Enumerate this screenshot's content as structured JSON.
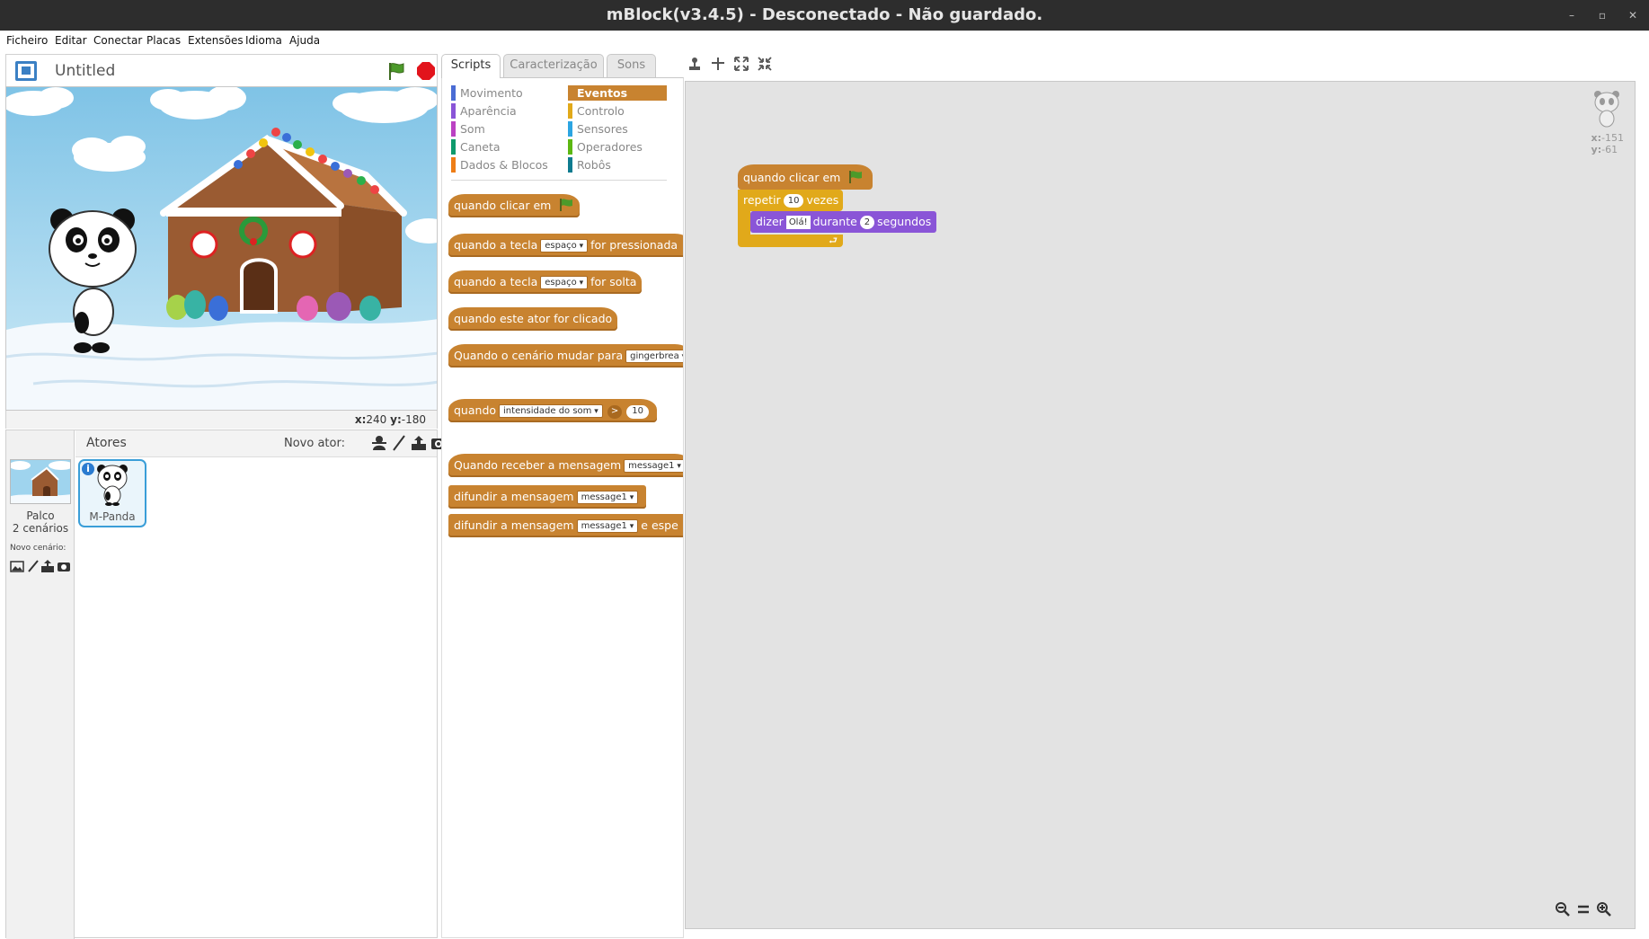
{
  "window": {
    "title": "mBlock(v3.4.5) - Desconectado - Não guardado.",
    "controls": [
      "–",
      "▫",
      "✕"
    ]
  },
  "menu": [
    "Ficheiro",
    "Editar",
    "Conectar",
    "Placas",
    "Extensões",
    "Idioma",
    "Ajuda"
  ],
  "stage": {
    "project_title": "Untitled",
    "coords": {
      "x_label": "x:",
      "x": "240",
      "y_label": "y:",
      "y": "-180"
    }
  },
  "sprites": {
    "header": "Atores",
    "new_sprite": "Novo ator:",
    "stage_label": "Palco",
    "stage_backdrops": "2 cenários",
    "new_backdrop": "Novo cenário:",
    "list": [
      {
        "name": "M-Panda",
        "info": "i"
      }
    ]
  },
  "tabs": [
    "Scripts",
    "Caracterização",
    "Sons"
  ],
  "categories": [
    {
      "label": "Movimento",
      "color": "#4a6cd4",
      "selected": false
    },
    {
      "label": "Eventos",
      "color": "#c88330",
      "selected": true
    },
    {
      "label": "Aparência",
      "color": "#8a55d7",
      "selected": false
    },
    {
      "label": "Controlo",
      "color": "#e1a91a",
      "selected": false
    },
    {
      "label": "Som",
      "color": "#bb42c3",
      "selected": false
    },
    {
      "label": "Sensores",
      "color": "#2ca5e2",
      "selected": false
    },
    {
      "label": "Caneta",
      "color": "#0e9a6c",
      "selected": false
    },
    {
      "label": "Operadores",
      "color": "#5cb712",
      "selected": false
    },
    {
      "label": "Dados & Blocos",
      "color": "#ee7d16",
      "selected": false
    },
    {
      "label": "Robôs",
      "color": "#0e7b8f",
      "selected": false
    }
  ],
  "palette_blocks": {
    "b1": {
      "t1": "quando clicar em"
    },
    "b2": {
      "t1": "quando a tecla",
      "dd": "espaço",
      "t2": "for pressionada"
    },
    "b3": {
      "t1": "quando a tecla",
      "dd": "espaço",
      "t2": "for solta"
    },
    "b4": {
      "t1": "quando este ator for clicado"
    },
    "b5": {
      "t1": "Quando o cenário mudar para",
      "dd": "gingerbrea"
    },
    "b6": {
      "t1": "quando",
      "dd": "intensidade do som",
      "op": ">",
      "num": "10"
    },
    "b7": {
      "t1": "Quando receber a mensagem",
      "dd": "message1"
    },
    "b8": {
      "t1": "difundir a mensagem",
      "dd": "message1"
    },
    "b9": {
      "t1": "difundir a mensagem",
      "dd": "message1",
      "t2": "e espe"
    }
  },
  "script": {
    "hat": "quando clicar em",
    "repeat": {
      "label": "repetir",
      "count": "10",
      "suffix": "vezes"
    },
    "say": {
      "label": "dizer",
      "text": "Olá!",
      "mid": "durante",
      "secs": "2",
      "suffix": "segundos"
    },
    "sprite_xy": {
      "x_label": "x:",
      "x": "-151",
      "y_label": "y:",
      "y": "-61"
    }
  },
  "colors": {
    "events": "#c88330",
    "control": "#e1a91a",
    "looks": "#8a55d7",
    "accent": "#3a9ed8"
  }
}
